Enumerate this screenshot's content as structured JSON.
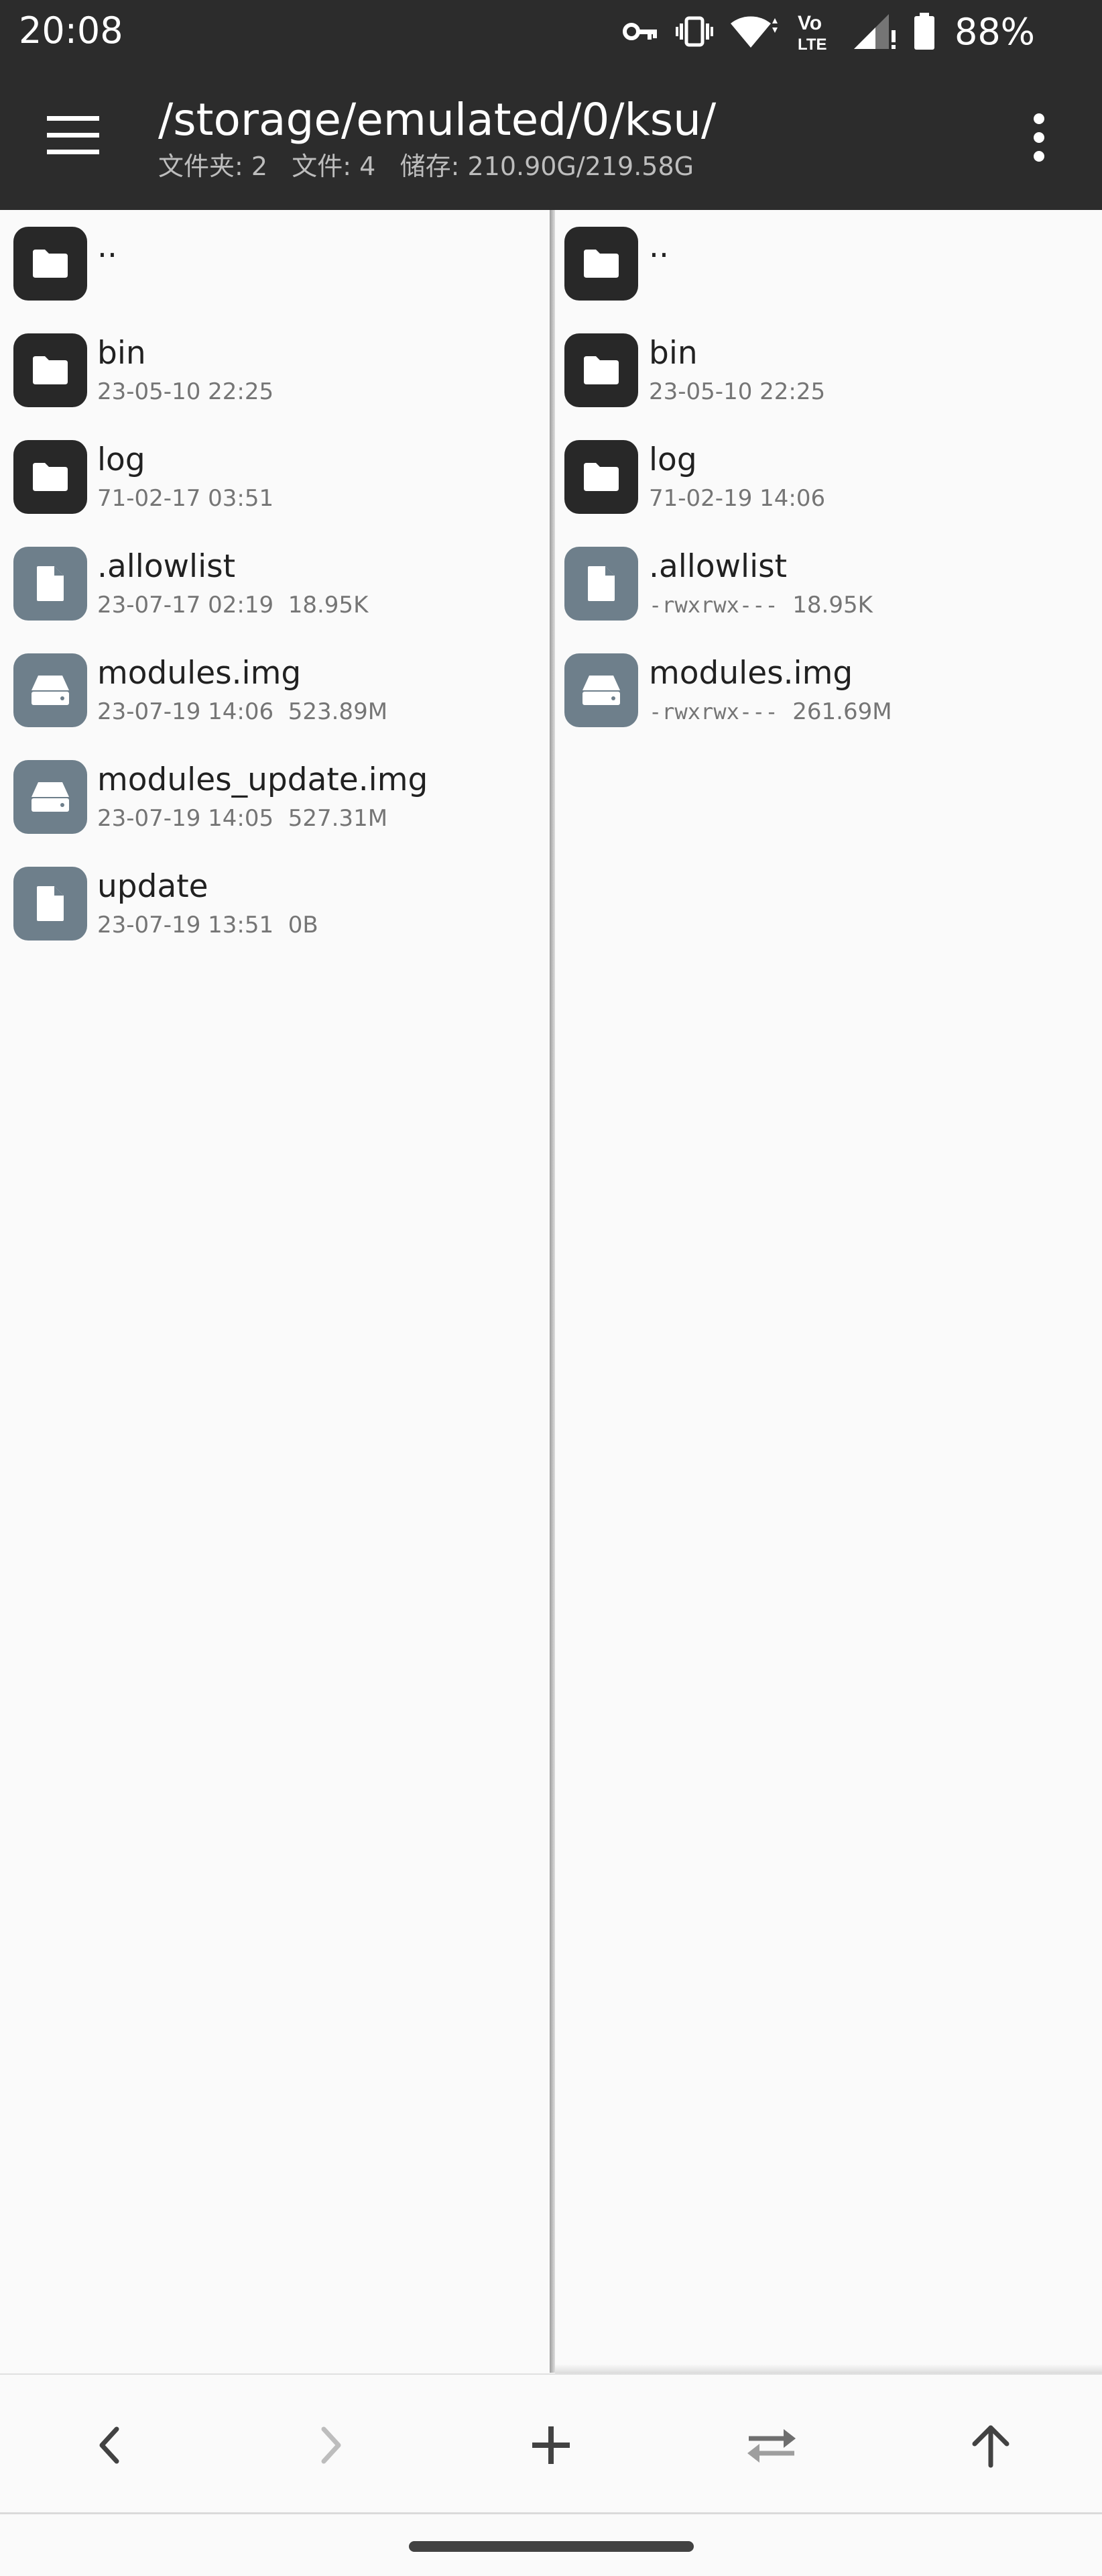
{
  "status_bar": {
    "time": "20:08",
    "battery": "88%",
    "icons": [
      "vpn-key-icon",
      "vibrate-icon",
      "wifi-icon",
      "volte-icon",
      "signal-icon",
      "battery-icon"
    ],
    "volte_label_top": "Vo",
    "volte_label_bottom": "LTE"
  },
  "app_bar": {
    "path": "/storage/emulated/0/ksu/",
    "info": "文件夹: 2   文件: 4   储存: 210.90G/219.58G"
  },
  "left_pane": [
    {
      "name": "..",
      "meta": "",
      "type": "folder"
    },
    {
      "name": "bin",
      "meta": "23-05-10 22:25",
      "type": "folder"
    },
    {
      "name": "log",
      "meta": "71-02-17 03:51",
      "type": "folder"
    },
    {
      "name": ".allowlist",
      "meta": "23-07-17 02:19  18.95K",
      "type": "file"
    },
    {
      "name": "modules.img",
      "meta": "23-07-19 14:06  523.89M",
      "type": "disk"
    },
    {
      "name": "modules_update.img",
      "meta": "23-07-19 14:05  527.31M",
      "type": "disk"
    },
    {
      "name": "update",
      "meta": "23-07-19 13:51  0B",
      "type": "file"
    }
  ],
  "right_pane": [
    {
      "name": "..",
      "meta": "",
      "type": "folder"
    },
    {
      "name": "bin",
      "meta": "23-05-10 22:25",
      "type": "folder"
    },
    {
      "name": "log",
      "meta": "71-02-19 14:06",
      "type": "folder"
    },
    {
      "name": ".allowlist",
      "perms": "-rwxrwx---",
      "size": "18.95K",
      "type": "file"
    },
    {
      "name": "modules.img",
      "perms": "-rwxrwx---",
      "size": "261.69M",
      "type": "disk"
    }
  ],
  "bottom_nav": [
    "back-icon",
    "forward-icon",
    "add-icon",
    "swap-icon",
    "up-icon"
  ],
  "colors": {
    "toolbar": "#2c2c2c",
    "folder_icon_bg": "#282828",
    "file_icon_bg": "#6e7f8b",
    "background": "#fafafa"
  }
}
